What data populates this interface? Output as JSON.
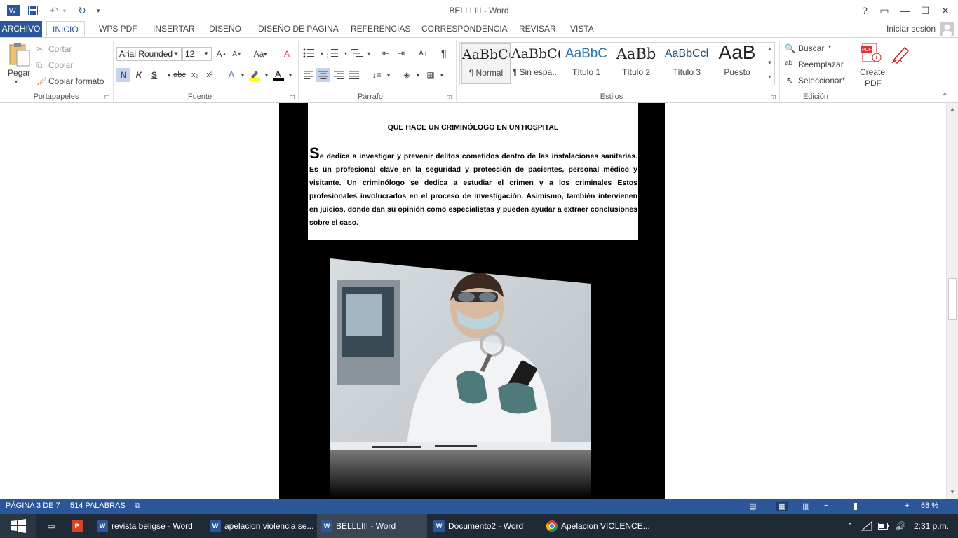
{
  "window": {
    "title": "BELLLIII - Word"
  },
  "quick_access": {
    "app_icon": "word-icon",
    "save_icon": "save-icon",
    "undo_icon": "undo-icon",
    "redo_icon": "redo-icon",
    "customize_icon": "customize-icon"
  },
  "title_buttons": {
    "help": "?",
    "ribbon_display": "▭",
    "minimize": "—",
    "maximize": "☐",
    "close": "✕"
  },
  "tabs": [
    {
      "label": "ARCHIVO"
    },
    {
      "label": "INICIO"
    },
    {
      "label": "WPS PDF"
    },
    {
      "label": "INSERTAR"
    },
    {
      "label": "DISEÑO"
    },
    {
      "label": "DISEÑO DE PÁGINA"
    },
    {
      "label": "REFERENCIAS"
    },
    {
      "label": "CORRESPONDENCIA"
    },
    {
      "label": "REVISAR"
    },
    {
      "label": "VISTA"
    }
  ],
  "account": {
    "signin": "Iniciar sesión"
  },
  "ribbon": {
    "clipboard": {
      "paste": "Pegar",
      "cut": "Cortar",
      "copy": "Copiar",
      "format_painter": "Copiar formato",
      "group": "Portapapeles"
    },
    "font": {
      "name": "Arial Rounded",
      "size": "12",
      "bold": "N",
      "italic": "K",
      "underline": "S",
      "strike": "abc",
      "sub": "x₂",
      "sup": "x²",
      "case": "Aa",
      "group": "Fuente"
    },
    "paragraph": {
      "group": "Párrafo",
      "pilcrow": "¶"
    },
    "styles": {
      "items": [
        {
          "sample": "AaBbC(",
          "name": "¶ Normal"
        },
        {
          "sample": "AaBbC(",
          "name": "¶ Sin espa..."
        },
        {
          "sample": "AaBbC",
          "name": "Título 1"
        },
        {
          "sample": "AaBb",
          "name": "Título 2"
        },
        {
          "sample": "AaBbCcl",
          "name": "Título 3"
        },
        {
          "sample": "AaB",
          "name": "Puesto"
        }
      ],
      "group": "Estilos"
    },
    "editing": {
      "find": "Buscar",
      "replace": "Reemplazar",
      "select": "Seleccionar",
      "group": "Edición"
    },
    "pdf": {
      "create": "Create",
      "pdf": "PDF"
    }
  },
  "document": {
    "heading": "QUE HACE UN CRIMINÓLOGO EN UN HOSPITAL",
    "drop_cap": "S",
    "body": "e dedica a investigar y prevenir delitos cometidos dentro de las instalaciones sanitarias. Es un profesional clave en la seguridad y protección de pacientes, personal médico y visitante. Un criminólogo se dedica a estudiar el crimen y a los criminales Estos profesionales involucrados en el proceso de investigación. Asimismo, también intervienen en juicios, donde dan su opinión como especialistas y pueden ayudar a extraer conclusiones sobre el caso."
  },
  "status": {
    "page": "PÁGINA 3 DE 7",
    "words": "514 PALABRAS",
    "zoom": "68 %"
  },
  "zoom_level_percent": 68,
  "taskbar": {
    "items": [
      {
        "label": "revista beligse - Word",
        "icon": "word-icon"
      },
      {
        "label": "apelacion violencia se...",
        "icon": "word-icon"
      },
      {
        "label": "BELLLIII - Word",
        "icon": "word-icon"
      },
      {
        "label": "Documento2 - Word",
        "icon": "word-icon"
      },
      {
        "label": "Apelacion VIOLENCE...",
        "icon": "chrome-icon"
      }
    ],
    "clock": "2:31 p.m."
  },
  "colors": {
    "accent": "#2b579a",
    "taskbar": "#1f2a36"
  }
}
